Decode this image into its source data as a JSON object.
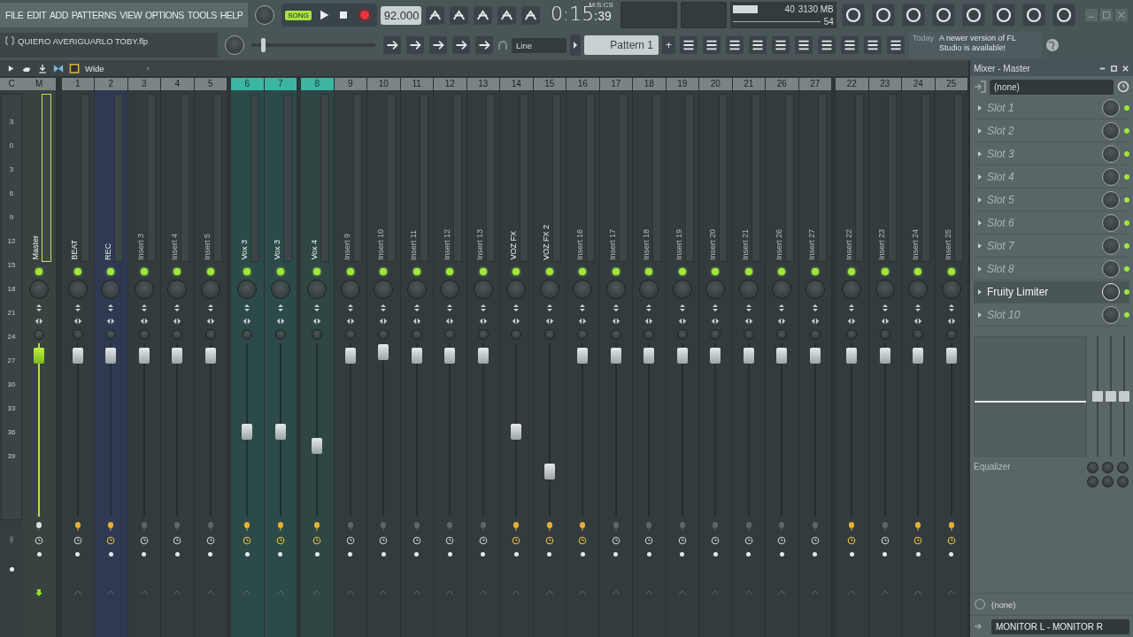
{
  "menu": [
    "FILE",
    "EDIT",
    "ADD",
    "PATTERNS",
    "VIEW",
    "OPTIONS",
    "TOOLS",
    "HELP"
  ],
  "transport": {
    "mode": "SONG",
    "tempo": "92.000"
  },
  "time": {
    "main": "0:15",
    "sub": ":39",
    "unit": "M:S:CS"
  },
  "monitor": {
    "polyphony": "40",
    "memory": "3130 MB",
    "cpu": "54"
  },
  "project": {
    "file": "QUIERO AVERIGUARLO TOBY.flp"
  },
  "pitch": {
    "level": 0.08
  },
  "snap": "Line",
  "pattern": {
    "name": "Pattern 1",
    "add": "+"
  },
  "news": {
    "when": "Today",
    "text": "A newer version of FL Studio is available!"
  },
  "mixer": {
    "view": "Wide",
    "scale_header": "C",
    "scale": [
      "3",
      "0",
      "3",
      "6",
      "9",
      "12",
      "15",
      "18",
      "21",
      "24",
      "27",
      "30",
      "33",
      "36",
      "39"
    ],
    "tracks": [
      {
        "kind": "master",
        "num": "M",
        "name": "Master",
        "named": true,
        "level": 0.93,
        "armed": false,
        "clock": false
      },
      {
        "kind": "insert",
        "num": "1",
        "name": "BEAT",
        "named": true,
        "level": 0.93,
        "armed": true,
        "clock": false
      },
      {
        "kind": "insert",
        "num": "2",
        "name": "REC",
        "named": true,
        "level": 0.93,
        "armed": true,
        "clock": true,
        "color": "#2f3a52"
      },
      {
        "kind": "insert",
        "num": "3",
        "name": "Insert 3",
        "named": false,
        "level": 0.93,
        "armed": false,
        "clock": false
      },
      {
        "kind": "insert",
        "num": "4",
        "name": "Insert 4",
        "named": false,
        "level": 0.93,
        "armed": false,
        "clock": false
      },
      {
        "kind": "insert",
        "num": "5",
        "name": "Insert 5",
        "named": false,
        "level": 0.93,
        "armed": false,
        "clock": false
      },
      {
        "kind": "insert",
        "num": "6",
        "name": "Vox 3",
        "named": true,
        "level": 0.49,
        "armed": true,
        "clock": true,
        "color": "#2c4a47",
        "selected": true
      },
      {
        "kind": "insert",
        "num": "7",
        "name": "Vox 3",
        "named": true,
        "level": 0.49,
        "armed": true,
        "clock": true,
        "color": "#2c4a47",
        "selected": true
      },
      {
        "kind": "insert",
        "num": "8",
        "name": "Vox 4",
        "named": true,
        "level": 0.41,
        "armed": true,
        "clock": true,
        "color": "#2e4644",
        "selected": true
      },
      {
        "kind": "insert",
        "num": "9",
        "name": "Insert 9",
        "named": false,
        "level": 0.93,
        "armed": false,
        "clock": false
      },
      {
        "kind": "insert",
        "num": "10",
        "name": "Insert 10",
        "named": false,
        "level": 0.95,
        "armed": false,
        "clock": false
      },
      {
        "kind": "insert",
        "num": "11",
        "name": "Insert 11",
        "named": false,
        "level": 0.93,
        "armed": false,
        "clock": false
      },
      {
        "kind": "insert",
        "num": "12",
        "name": "Insert 12",
        "named": false,
        "level": 0.93,
        "armed": false,
        "clock": false
      },
      {
        "kind": "insert",
        "num": "13",
        "name": "Insert 13",
        "named": false,
        "level": 0.93,
        "armed": false,
        "clock": false
      },
      {
        "kind": "insert",
        "num": "14",
        "name": "VOZ FX",
        "named": true,
        "level": 0.49,
        "armed": true,
        "clock": true
      },
      {
        "kind": "insert",
        "num": "15",
        "name": "VOZ FX 2",
        "named": true,
        "level": 0.26,
        "armed": true,
        "clock": true
      },
      {
        "kind": "insert",
        "num": "16",
        "name": "Insert 16",
        "named": false,
        "level": 0.93,
        "armed": true,
        "clock": true
      },
      {
        "kind": "insert",
        "num": "17",
        "name": "Insert 17",
        "named": false,
        "level": 0.93,
        "armed": false,
        "clock": false
      },
      {
        "kind": "insert",
        "num": "18",
        "name": "Insert 18",
        "named": false,
        "level": 0.93,
        "armed": false,
        "clock": false
      },
      {
        "kind": "insert",
        "num": "19",
        "name": "Insert 19",
        "named": false,
        "level": 0.93,
        "armed": false,
        "clock": false
      },
      {
        "kind": "insert",
        "num": "20",
        "name": "Insert 20",
        "named": false,
        "level": 0.93,
        "armed": false,
        "clock": false
      },
      {
        "kind": "insert",
        "num": "21",
        "name": "Insert 21",
        "named": false,
        "level": 0.93,
        "armed": false,
        "clock": false
      },
      {
        "kind": "insert",
        "num": "26",
        "name": "Insert 26",
        "named": false,
        "level": 0.93,
        "armed": false,
        "clock": false
      },
      {
        "kind": "insert",
        "num": "27",
        "name": "Insert 27",
        "named": false,
        "level": 0.93,
        "armed": false,
        "clock": false
      },
      {
        "kind": "insert",
        "num": "22",
        "name": "Insert 22",
        "named": false,
        "level": 0.93,
        "armed": true,
        "clock": true
      },
      {
        "kind": "insert",
        "num": "23",
        "name": "Insert 23",
        "named": false,
        "level": 0.93,
        "armed": false,
        "clock": false
      },
      {
        "kind": "insert",
        "num": "24",
        "name": "Insert 24",
        "named": false,
        "level": 0.93,
        "armed": true,
        "clock": true
      },
      {
        "kind": "insert",
        "num": "25",
        "name": "Insert 25",
        "named": false,
        "level": 0.93,
        "armed": true,
        "clock": true
      }
    ]
  },
  "panel": {
    "title": "Mixer - Master",
    "input": "(none)",
    "slots": [
      {
        "label": "Slot 1",
        "loaded": false
      },
      {
        "label": "Slot 2",
        "loaded": false
      },
      {
        "label": "Slot 3",
        "loaded": false
      },
      {
        "label": "Slot 4",
        "loaded": false
      },
      {
        "label": "Slot 5",
        "loaded": false
      },
      {
        "label": "Slot 6",
        "loaded": false
      },
      {
        "label": "Slot 7",
        "loaded": false
      },
      {
        "label": "Slot 8",
        "loaded": false
      },
      {
        "label": "Fruity Limiter",
        "loaded": true
      },
      {
        "label": "Slot 10",
        "loaded": false
      }
    ],
    "eq_label": "Equalizer",
    "output_top": "(none)",
    "output": "MONITOR L - MONITOR R"
  }
}
